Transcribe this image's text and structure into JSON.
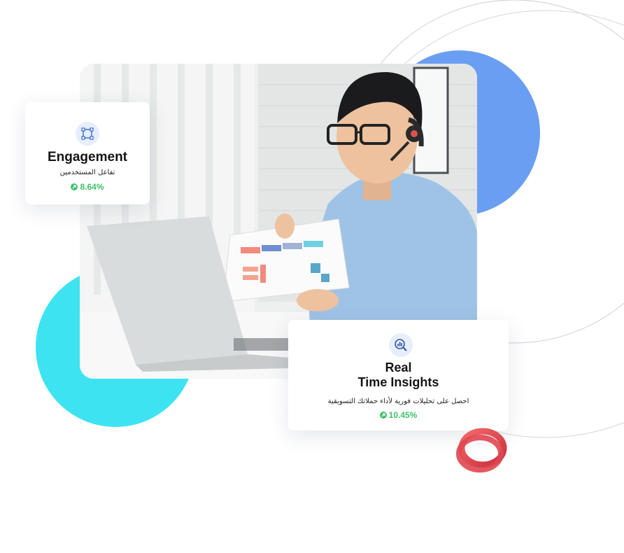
{
  "colors": {
    "accent_blue": "#6a9ef2",
    "accent_cyan": "#3ee3f2",
    "positive_green": "#3fc16a",
    "ring_red": "#e84848"
  },
  "cards": {
    "engagement": {
      "icon": "nodes-square-icon",
      "title": "Engagement",
      "subtitle": "تفاعل المستخدمين",
      "stat": "8.64%"
    },
    "insights": {
      "icon": "magnify-chart-icon",
      "title_line1": "Real",
      "title_line2": "Time Insights",
      "subtitle": "احصل على تحليلات فورية لأداء حملاتك التسويقية",
      "stat": "10.45%"
    }
  },
  "hero": {
    "image": "man-with-headset-holding-chart-at-laptop"
  }
}
